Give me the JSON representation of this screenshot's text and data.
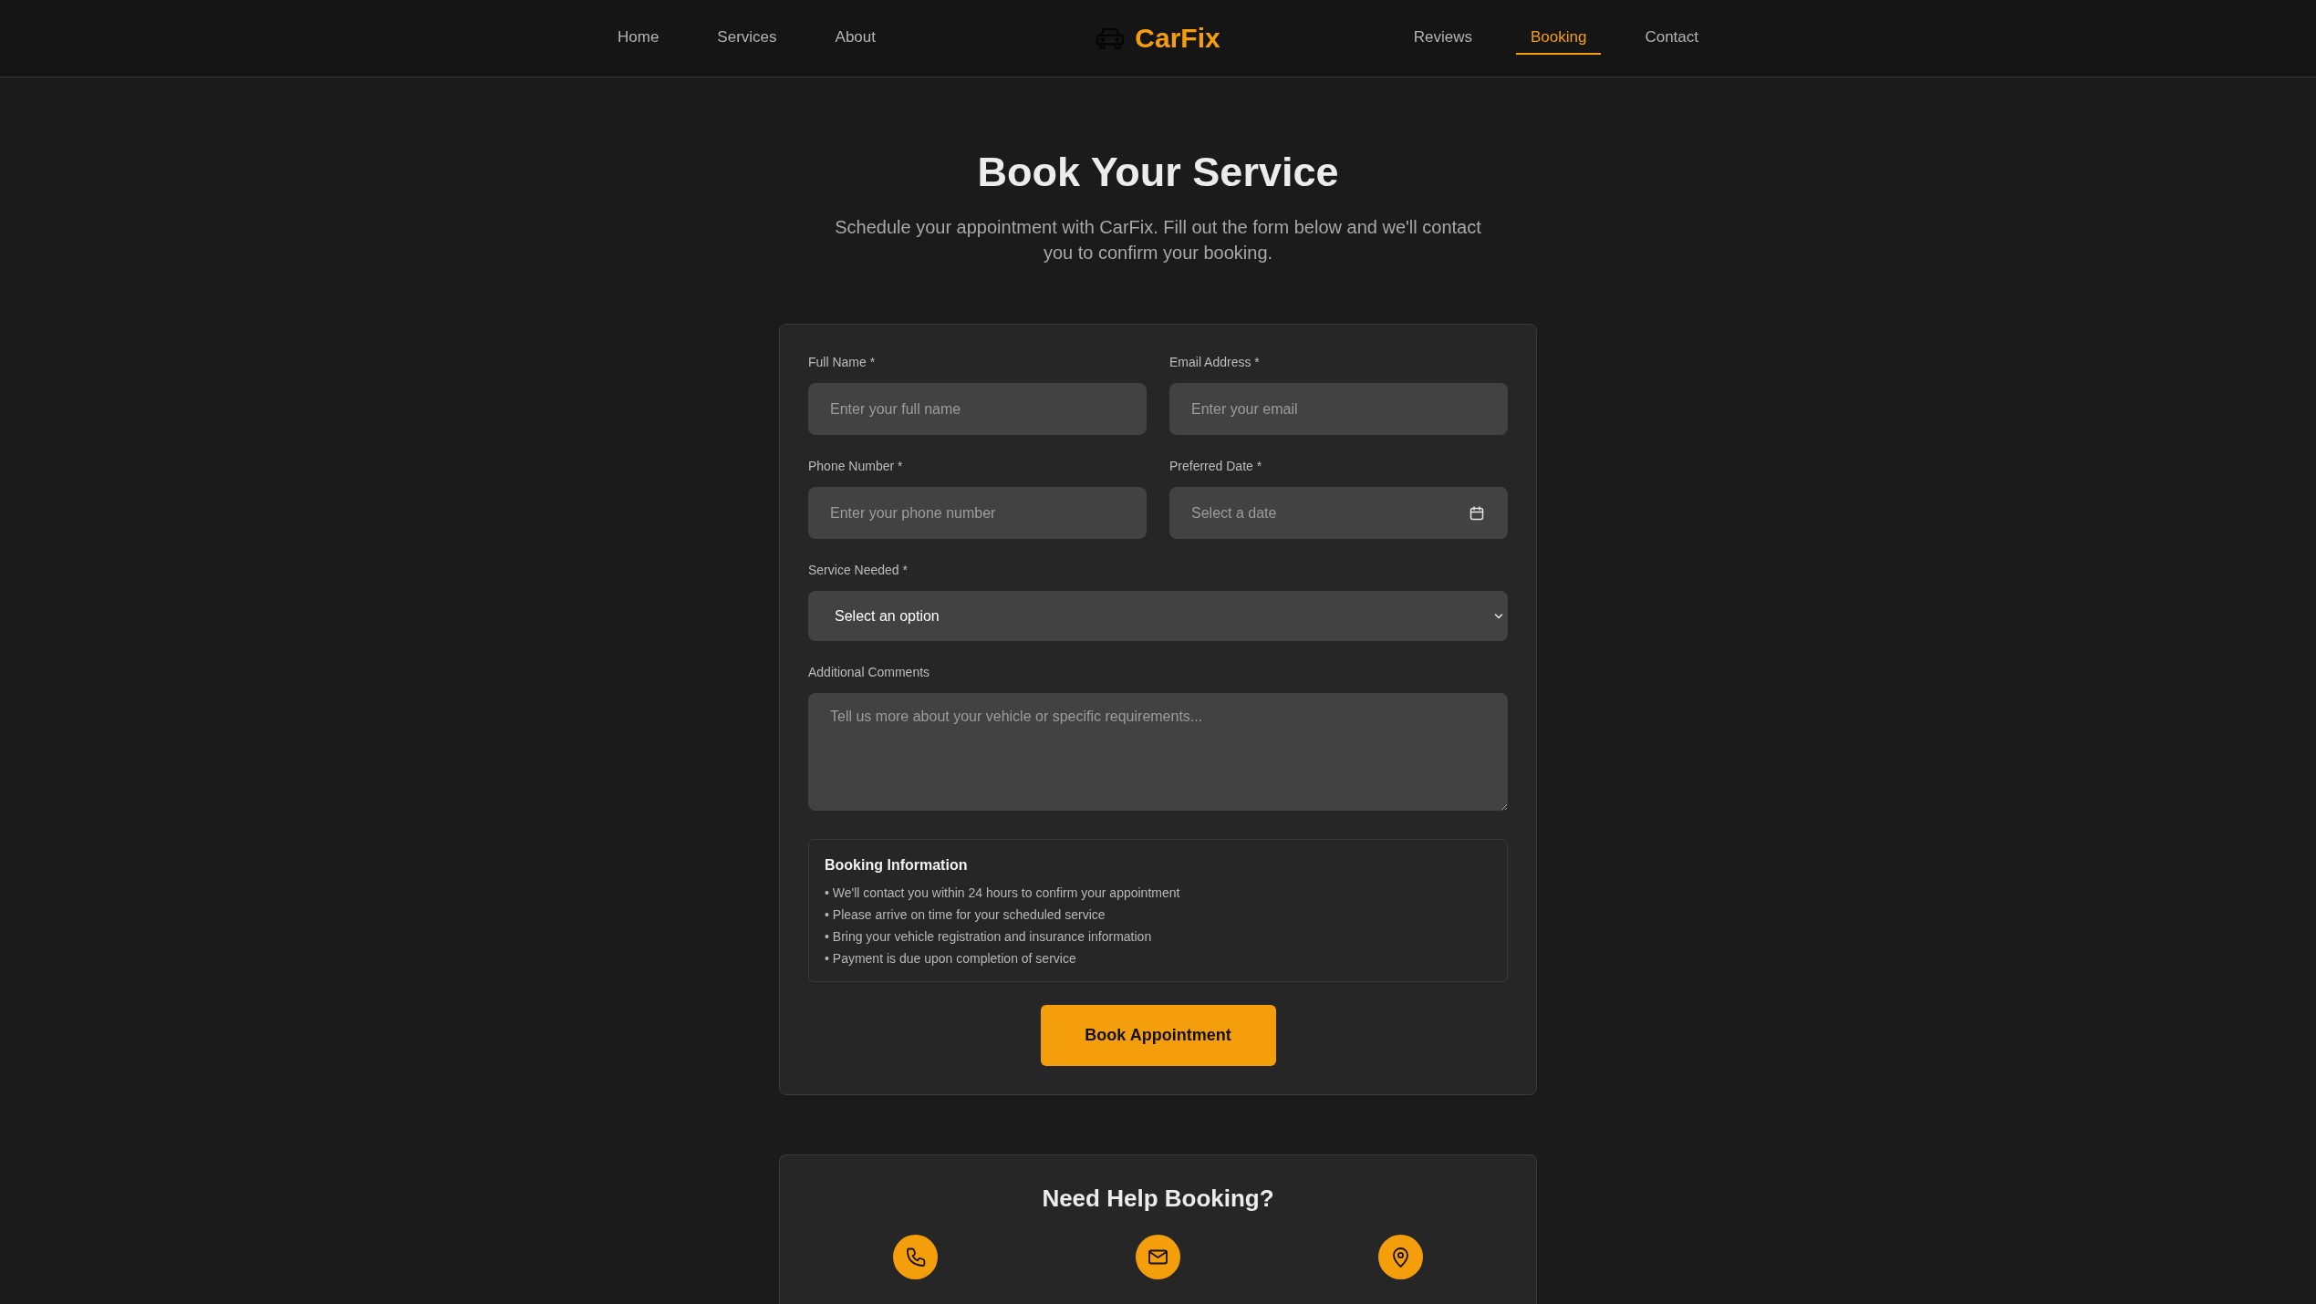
{
  "nav": {
    "links_left": [
      {
        "label": "Home",
        "selected": false
      },
      {
        "label": "Services",
        "selected": false
      },
      {
        "label": "About",
        "selected": false
      }
    ],
    "logo": {
      "text": "CarFix"
    },
    "links_right": [
      {
        "label": "Reviews",
        "selected": false
      },
      {
        "label": "Booking",
        "selected": true
      },
      {
        "label": "Contact",
        "selected": false
      }
    ]
  },
  "hero": {
    "title": "Book Your Service",
    "subtitle": "Schedule your appointment with CarFix. Fill out the form below and we'll contact you to confirm your booking."
  },
  "booking_form": {
    "fields": [
      {
        "kind": "input",
        "label": "Full Name *",
        "placeholder": "Enter your full name"
      },
      {
        "kind": "input",
        "label": "Email Address *",
        "placeholder": "Enter your email"
      },
      {
        "kind": "input",
        "label": "Phone Number *",
        "placeholder": "Enter your phone number"
      },
      {
        "kind": "date",
        "label": "Preferred Date *",
        "placeholder": "Select a date"
      },
      {
        "kind": "select",
        "label": "Service Needed *",
        "value": "Select an option"
      },
      {
        "kind": "textarea",
        "label": "Additional Comments",
        "placeholder": "Tell us more about your vehicle or specific requirements..."
      }
    ],
    "info": {
      "title": "Booking Information",
      "items": [
        "• We'll contact you within 24 hours to confirm your appointment",
        "• Please arrive on time for your scheduled service",
        "• Bring your vehicle registration and insurance information",
        "• Payment is due upon completion of service"
      ]
    },
    "submit_button": "Book Appointment"
  },
  "help": {
    "title": "Need Help Booking?",
    "contacts": [
      {
        "kind": "phone"
      },
      {
        "kind": "email"
      },
      {
        "kind": "location"
      }
    ]
  }
}
